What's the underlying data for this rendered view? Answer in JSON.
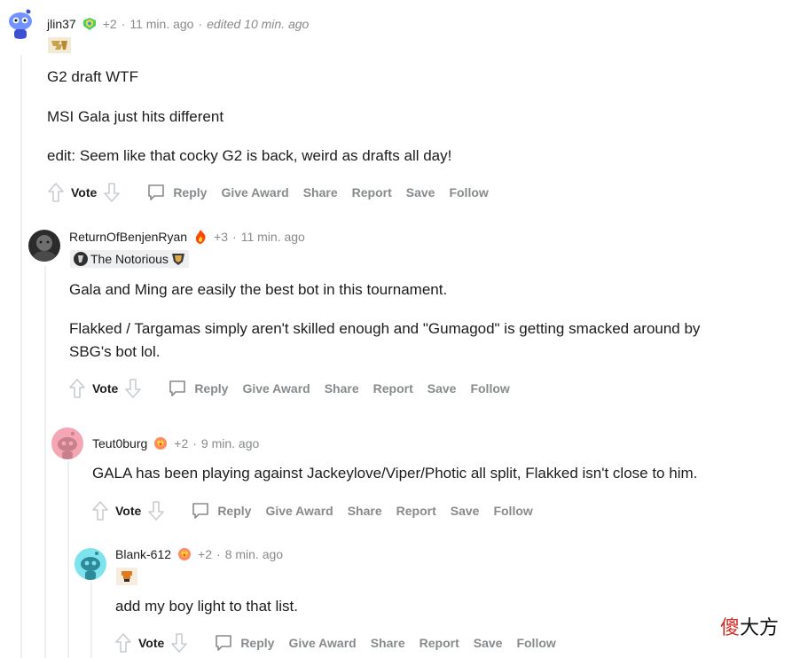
{
  "comments": [
    {
      "username": "jlin37",
      "award_count": "+2",
      "time": "11 min. ago",
      "edited": "edited 10 min. ago",
      "flair_text": "",
      "body": [
        "G2 draft WTF",
        "MSI Gala just hits different",
        "edit: Seem like that cocky G2 is back, weird as drafts all day!"
      ]
    },
    {
      "username": "ReturnOfBenjenRyan",
      "award_count": "+3",
      "time": "11 min. ago",
      "flair_text": "The Notorious",
      "body": [
        "Gala and Ming are easily the best bot in this tournament.",
        "Flakked / Targamas simply aren't skilled enough and \"Gumagod\" is getting smacked around by",
        "SBG's bot lol."
      ]
    },
    {
      "username": "Teut0burg",
      "award_count": "+2",
      "time": "9 min. ago",
      "flair_text": "",
      "body": [
        "GALA has been playing against Jackeylove/Viper/Photic all split, Flakked isn't close to him."
      ]
    },
    {
      "username": "Blank-612",
      "award_count": "+2",
      "time": "8 min. ago",
      "flair_text": "",
      "body": [
        "add my boy light to that list."
      ]
    }
  ],
  "actions": {
    "vote": "Vote",
    "reply": "Reply",
    "give_award": "Give Award",
    "share": "Share",
    "report": "Report",
    "save": "Save",
    "follow": "Follow"
  },
  "watermark": {
    "part1": "傻",
    "part2": "大方"
  },
  "colors": {
    "meta_gray": "#878a8c",
    "thread_line": "#edeff1",
    "watermark_red": "#d42a26"
  }
}
